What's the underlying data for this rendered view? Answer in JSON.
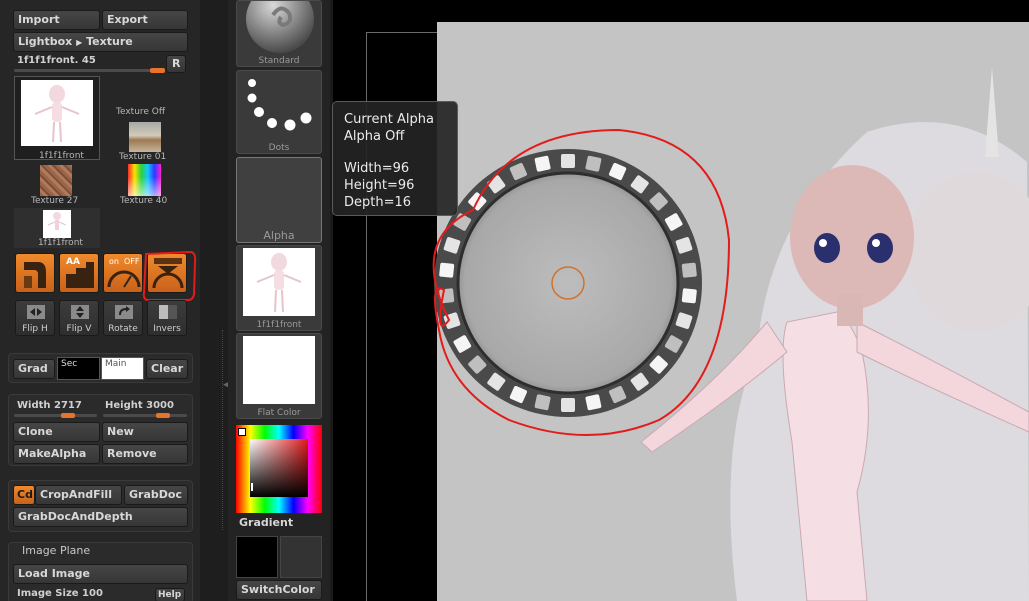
{
  "texture_palette": {
    "import_label": "Import",
    "export_label": "Export",
    "lightbox_label": "Lightbox",
    "lightbox_target": "Texture",
    "current_texture_name": "1f1f1front. 45",
    "reset_label": "R",
    "thumbs": [
      {
        "caption": "1f1f1front"
      },
      {
        "caption": "Texture Off"
      },
      {
        "caption": "Texture 01"
      },
      {
        "caption": "Texture 27"
      },
      {
        "caption": "Texture 40"
      },
      {
        "caption": "1f1f1front"
      }
    ],
    "transform_buttons": [
      {
        "icon": "flip-h-icon",
        "caption": "Flip H"
      },
      {
        "icon": "flip-v-icon",
        "caption": "Flip V"
      },
      {
        "icon": "rotate-icon",
        "caption": "Rotate"
      },
      {
        "icon": "invert-icon",
        "caption": "Invers"
      }
    ],
    "toggle_labels": {
      "aa": "AA",
      "on": "on",
      "off": "OFF"
    },
    "grad_label": "Grad",
    "sec_label": "Sec",
    "main_label": "Main",
    "clear_label": "Clear",
    "width_label": "Width",
    "width_value": "2717",
    "height_label": "Height",
    "height_value": "3000",
    "width_fraction": 0.68,
    "height_fraction": 0.75,
    "clone_label": "Clone",
    "new_label": "New",
    "makealpha_label": "MakeAlpha",
    "remove_label": "Remove",
    "cd_label": "Cd",
    "cropandfill_label": "CropAndFill",
    "grabdoc_label": "GrabDoc",
    "grabdocanddepth_label": "GrabDocAndDepth",
    "image_plane_title": "Image Plane",
    "load_image_label": "Load Image",
    "image_size_label": "Image Size",
    "image_size_value": "100",
    "help_label": "Help"
  },
  "alpha_palette": {
    "brush_caption": "Standard",
    "stroke_caption": "Dots",
    "alpha_caption": "Alpha",
    "texture_caption": "1f1f1front",
    "material_caption": "Flat Color",
    "gradient_label": "Gradient",
    "switchcolor_label": "SwitchColor"
  },
  "tooltip": {
    "line1": "Current Alpha",
    "line2": "Alpha Off",
    "width": "Width=96",
    "height": "Height=96",
    "depth": "Depth=16"
  },
  "colors": {
    "accent_orange": "#e8742b",
    "annotation_red": "#e41b1b",
    "panel_bg": "#262626",
    "canvas_bg": "#c4c4c4"
  }
}
